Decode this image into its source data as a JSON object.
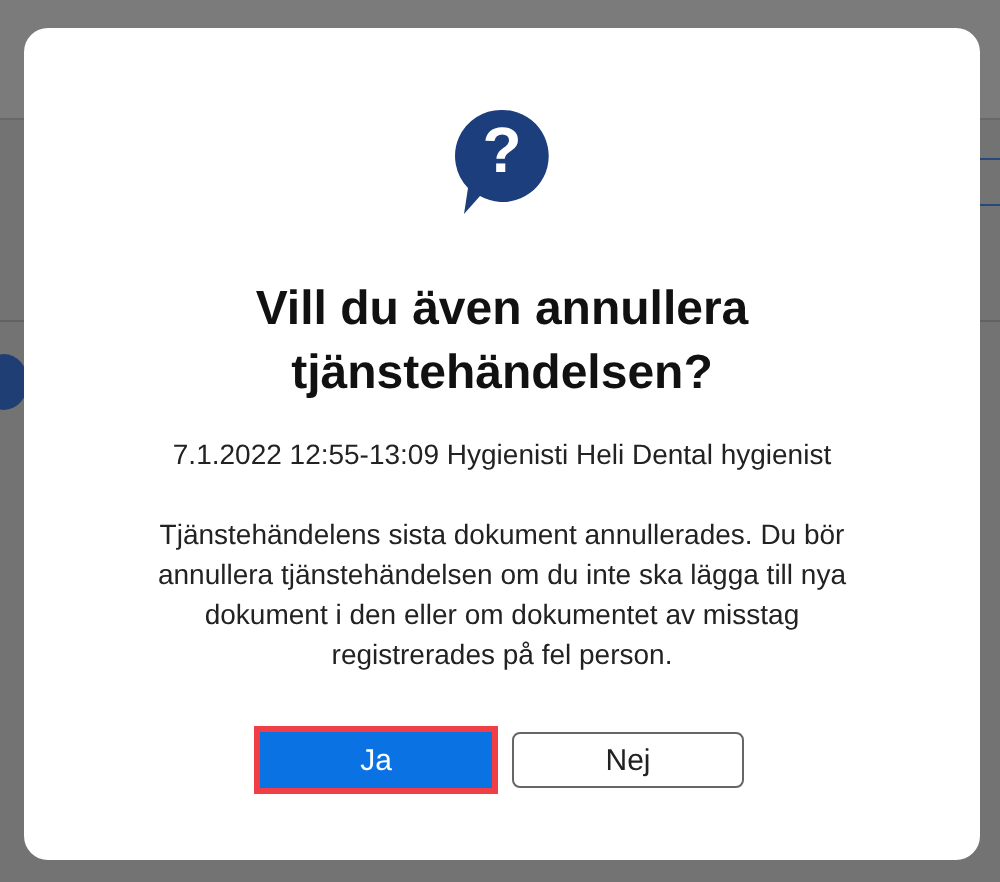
{
  "dialog": {
    "icon_glyph": "?",
    "title": "Vill du även annullera tjänstehändelsen?",
    "subtitle": "7.1.2022 12:55-13:09 Hygienisti Heli Dental hygienist",
    "message": "Tjänstehändelens sista dokument annullerades. Du bör annullera tjänstehändelsen om du inte ska lägga till nya dokument i den eller om dokumentet av misstag registrerades på fel person.",
    "buttons": [
      {
        "label": "Ja",
        "kind": "primary",
        "highlighted": true
      },
      {
        "label": "Nej",
        "kind": "secondary",
        "highlighted": false
      }
    ]
  }
}
